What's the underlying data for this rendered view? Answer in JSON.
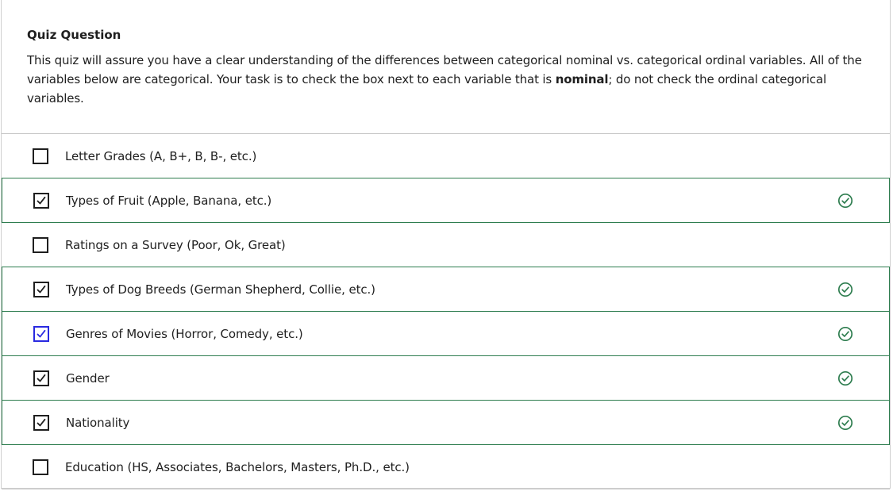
{
  "quiz": {
    "title": "Quiz Question",
    "prompt_before": "This quiz will assure you have a clear understanding of the differences between categorical nominal vs. categorical ordinal variables. All of the variables below are categorical. Your task is to check the box next to each variable that is ",
    "prompt_bold": "nominal",
    "prompt_after": "; do not check the ordinal categorical variables."
  },
  "options": [
    {
      "label": "Letter Grades (A, B+, B, B-, etc.)",
      "checked": false,
      "correct_indicator": false
    },
    {
      "label": "Types of Fruit (Apple, Banana, etc.)",
      "checked": true,
      "correct_indicator": true
    },
    {
      "label": "Ratings on a Survey (Poor, Ok, Great)",
      "checked": false,
      "correct_indicator": false
    },
    {
      "label": "Types of Dog Breeds (German Shepherd, Collie, etc.)",
      "checked": true,
      "correct_indicator": true
    },
    {
      "label": "Genres of Movies (Horror, Comedy, etc.)",
      "checked": true,
      "correct_indicator": true,
      "focused": true
    },
    {
      "label": "Gender",
      "checked": true,
      "correct_indicator": true
    },
    {
      "label": "Nationality",
      "checked": true,
      "correct_indicator": true
    },
    {
      "label": "Education (HS, Associates, Bachelors, Masters, Ph.D., etc.)",
      "checked": false,
      "correct_indicator": false
    }
  ],
  "colors": {
    "correct": "#2e7d4f",
    "focus": "#2a2ae0",
    "divider": "#c9c9c9"
  },
  "icons": {
    "checkmark": "checkmark-icon",
    "correct": "check-circle-icon"
  }
}
